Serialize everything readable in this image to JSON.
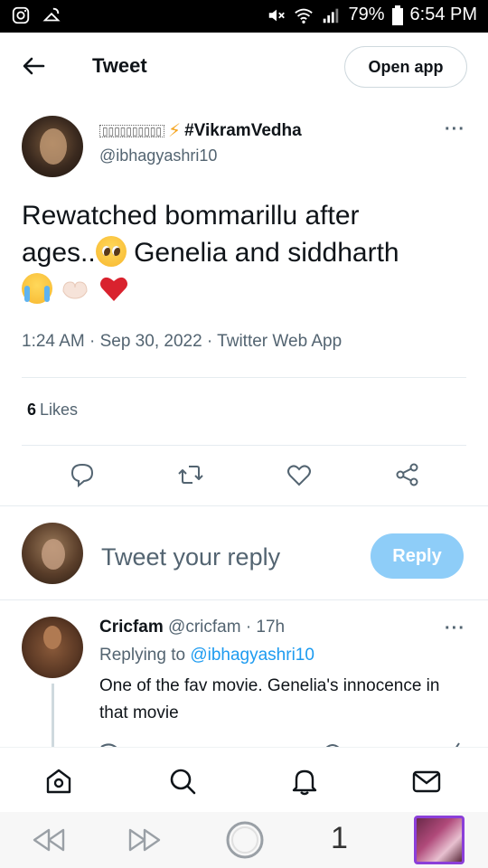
{
  "status_bar": {
    "battery": "79%",
    "time": "6:54 PM"
  },
  "header": {
    "title": "Tweet",
    "open_app_label": "Open app"
  },
  "tweet": {
    "author_name_box": "▯▯▯▯▯▯▯▯▯▯",
    "author_name_bolt": "⚡",
    "author_name_tag": "#VikramVedha",
    "author_handle": "@ibhagyashri10",
    "text_line1": "Rewatched bommarillu after",
    "text_line2a": "ages..",
    "text_line2b": " Genelia and siddharth",
    "timestamp": "1:24 AM · Sep 30, 2022 · Twitter Web App",
    "likes_count": "6",
    "likes_label": "Likes"
  },
  "composer": {
    "placeholder": "Tweet your reply",
    "reply_label": "Reply"
  },
  "reply": {
    "name": "Cricfam",
    "handle_time": " @cricfam · 17h",
    "replying_prefix": "Replying to ",
    "replying_to": "@ibhagyashri10",
    "text": "One of the fav movie. Genelia's innocence in that movie"
  },
  "browser": {
    "tab_count": "1"
  },
  "colors": {
    "accent": "#1d9bf0",
    "reply_button": "#8ecdf8",
    "heart": "#d9222e",
    "tab_border": "#8b3fd9"
  }
}
